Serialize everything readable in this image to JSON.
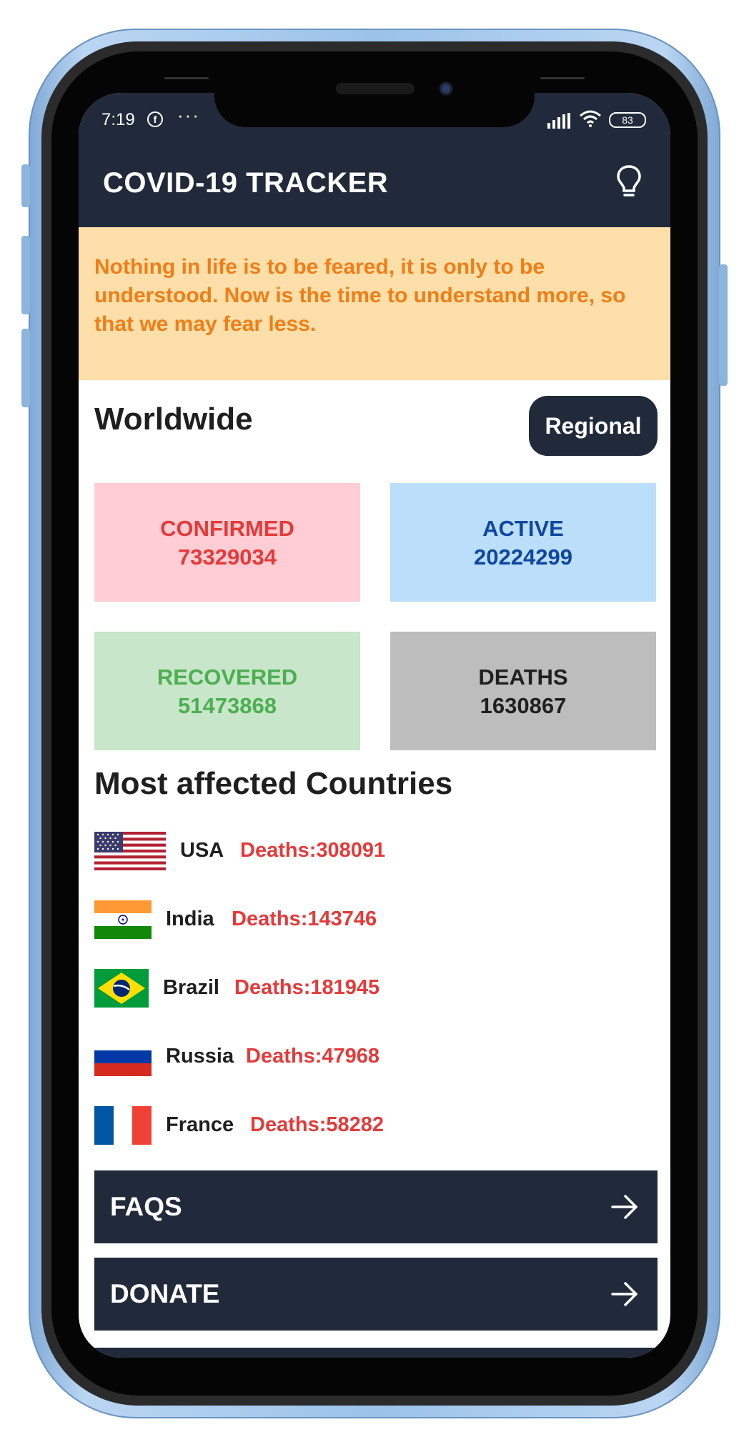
{
  "status_bar": {
    "time": "7:19",
    "fb_glyph": "f",
    "dots": "···",
    "battery": "83"
  },
  "app": {
    "title": "COVID-19 TRACKER",
    "theme_icon": "lightbulb-icon"
  },
  "quote": "Nothing in life is to be feared, it is only to be understood. Now is the time to understand more, so that we may fear less.",
  "worldwide": {
    "title": "Worldwide",
    "regional_button": "Regional",
    "stats": {
      "confirmed": {
        "label": "CONFIRMED",
        "value": "73329034"
      },
      "active": {
        "label": "ACTIVE",
        "value": "20224299"
      },
      "recovered": {
        "label": "RECOVERED",
        "value": "51473868"
      },
      "deaths": {
        "label": "DEATHS",
        "value": "1630867"
      }
    }
  },
  "most_affected": {
    "title": "Most affected Countries",
    "countries": [
      {
        "name": "USA",
        "deaths": "Deaths:308091",
        "flag": "usa-flag"
      },
      {
        "name": "India",
        "deaths": "Deaths:143746",
        "flag": "india-flag"
      },
      {
        "name": "Brazil",
        "deaths": "Deaths:181945",
        "flag": "brazil-flag"
      },
      {
        "name": "Russia",
        "deaths": "Deaths:47968",
        "flag": "russia-flag"
      },
      {
        "name": "France",
        "deaths": "Deaths:58282",
        "flag": "france-flag"
      }
    ]
  },
  "nav": {
    "faqs": "FAQS",
    "donate": "DONATE"
  },
  "colors": {
    "app_bar": "#202a3a",
    "quote_bg": "#fedfaa",
    "quote_text": "#f07e17",
    "confirmed_bg": "#ffcdd3",
    "active_bg": "#bbdefa",
    "recovered_bg": "#c8e6c9",
    "deaths_bg": "#bdbdbd",
    "death_text": "#e53a3a"
  }
}
